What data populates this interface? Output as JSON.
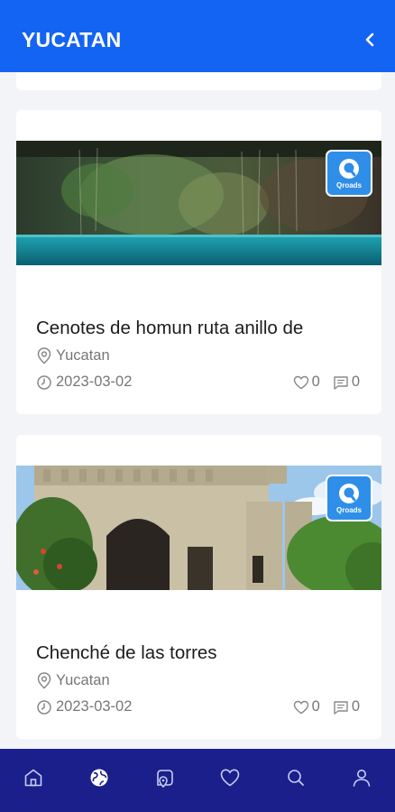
{
  "header": {
    "title": "YUCATAN"
  },
  "cards": [
    {
      "title": "Cenotes de homun ruta anillo de",
      "location": "Yucatan",
      "date": "2023-03-02",
      "likes": "0",
      "comments": "0",
      "badge": "Qroads"
    },
    {
      "title": "Chenché de las torres",
      "location": "Yucatan",
      "date": "2023-03-02",
      "likes": "0",
      "comments": "0",
      "badge": "Qroads"
    }
  ],
  "nav": {
    "items": [
      "home-icon",
      "globe-icon",
      "map-icon",
      "heart-icon",
      "search-icon",
      "profile-icon"
    ],
    "active": "globe-icon"
  },
  "colors": {
    "header": "#1464f4",
    "nav": "#1a1f8c",
    "badge": "#2e8ee8",
    "background": "#f3f4f7"
  }
}
